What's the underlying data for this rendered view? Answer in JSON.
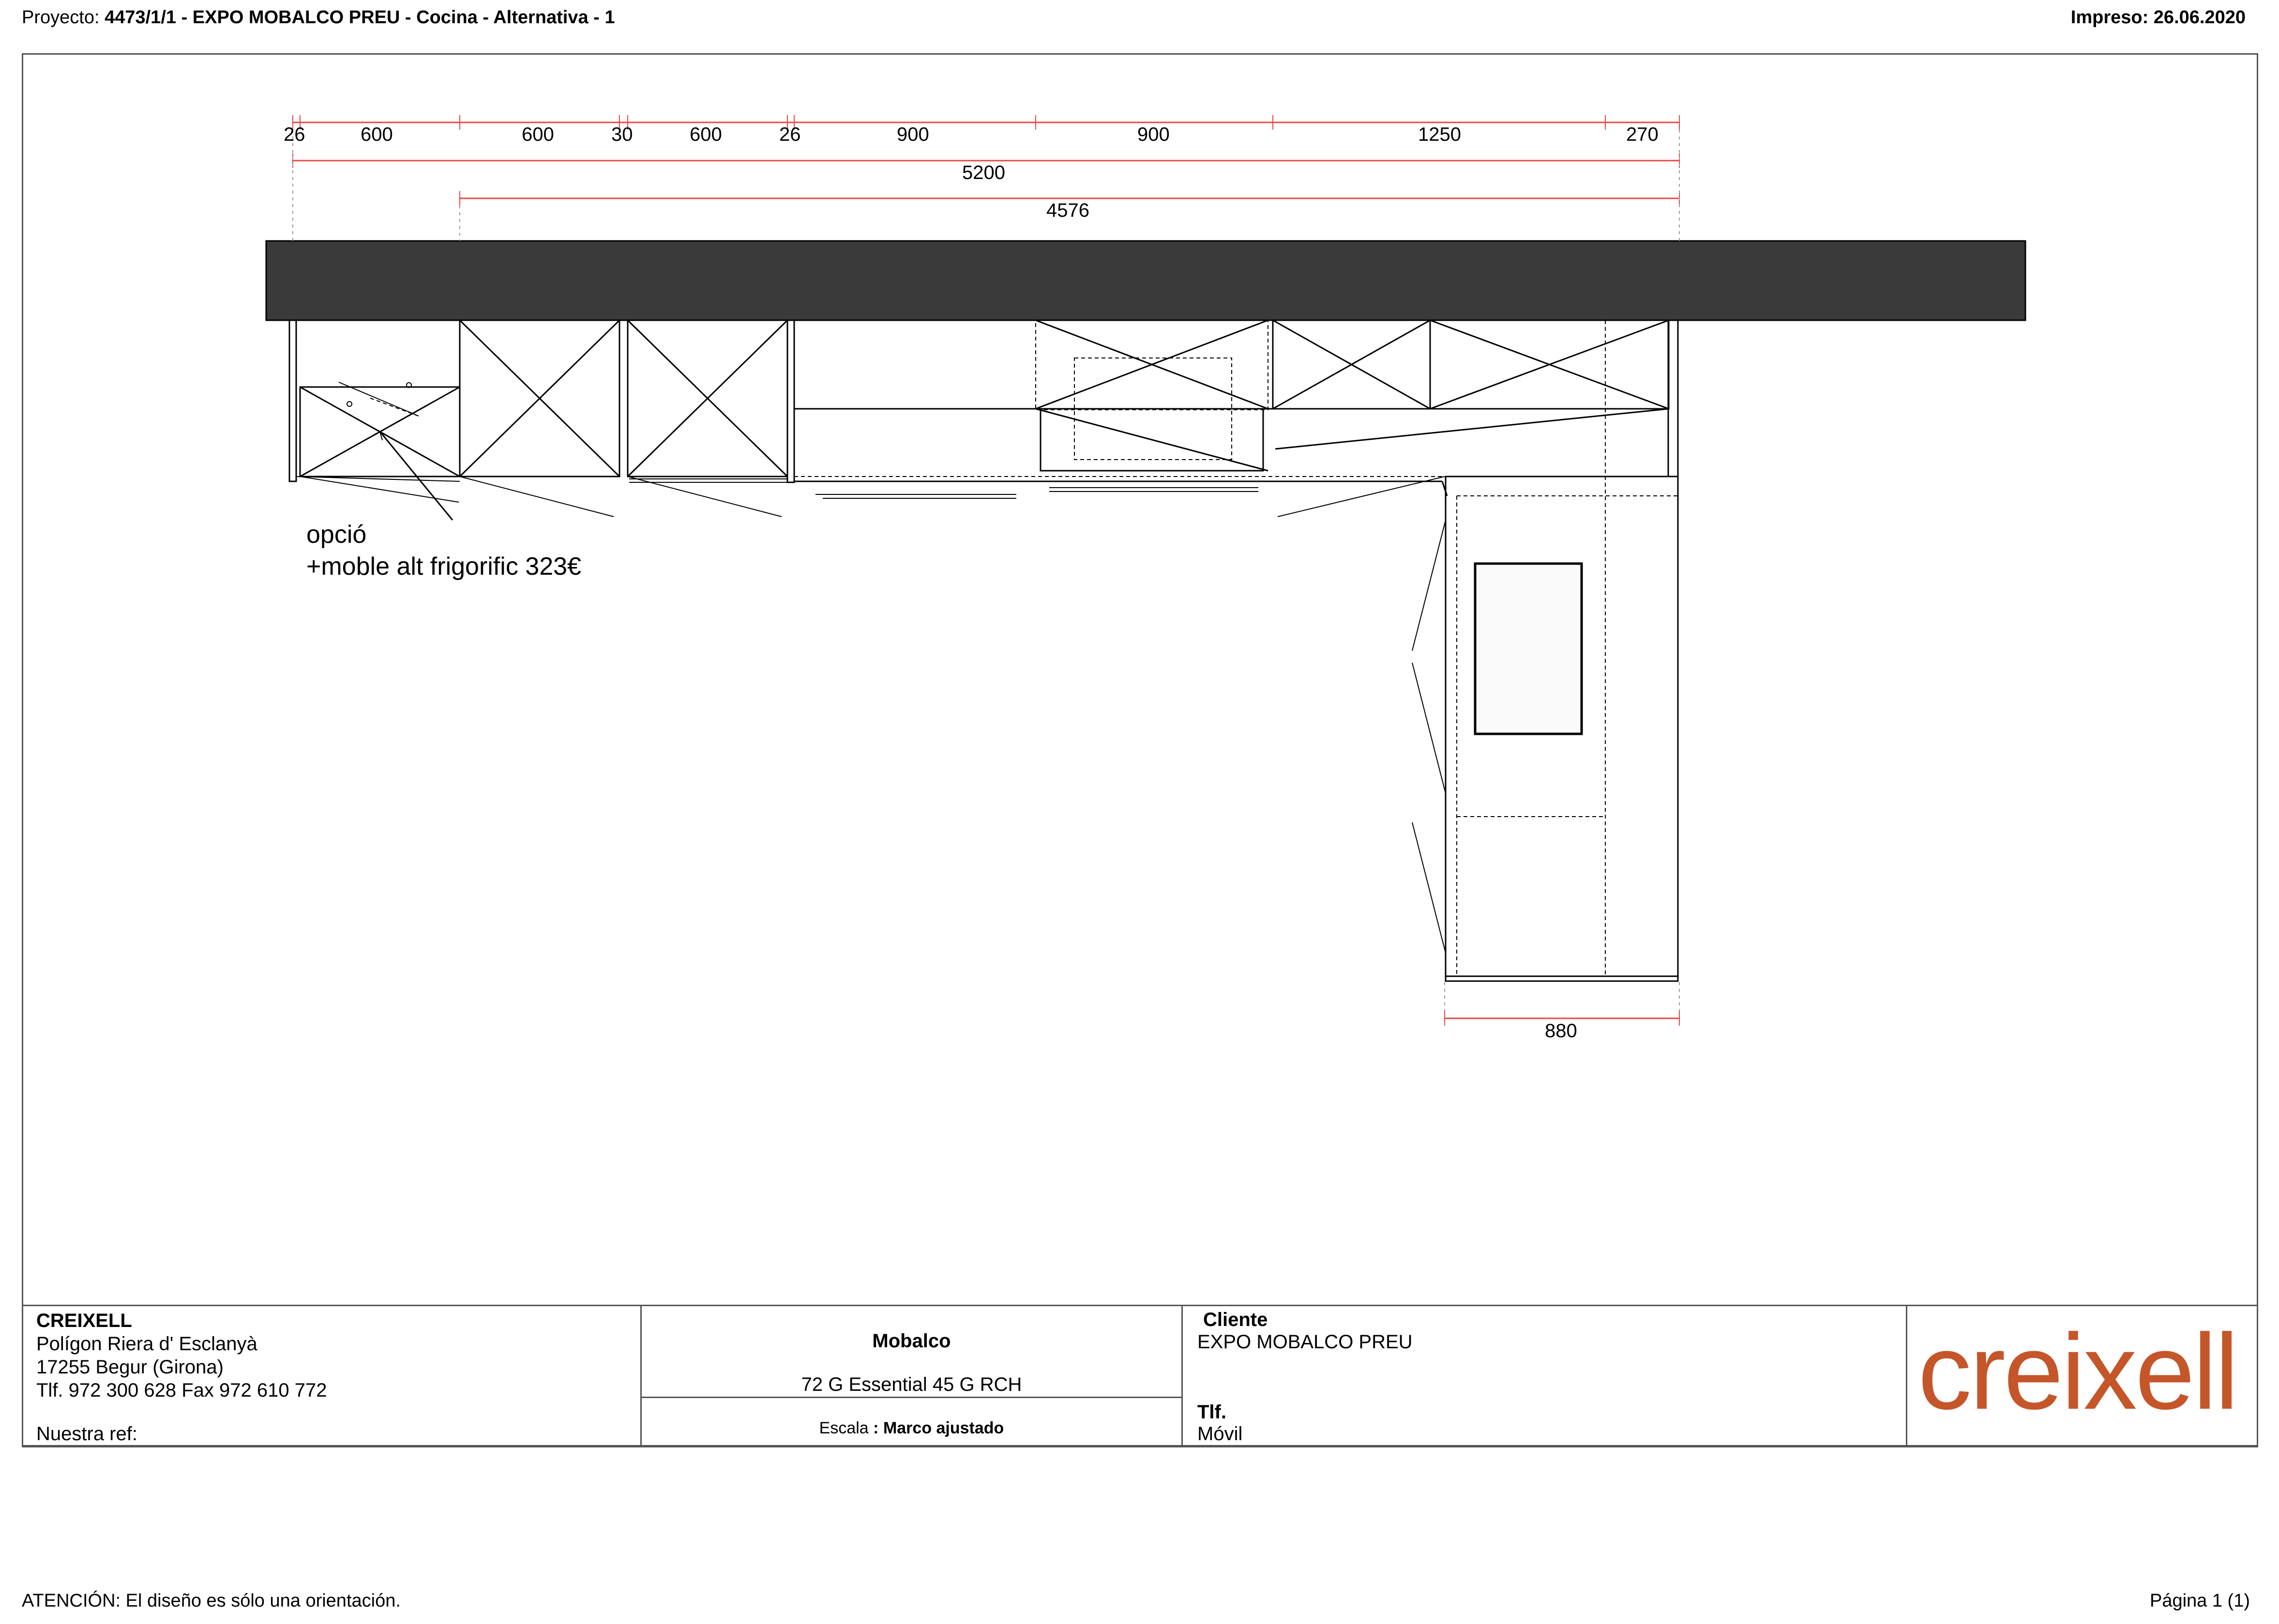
{
  "header": {
    "project_prefix": "Proyecto:",
    "project_name": "4473/1/1 - EXPO MOBALCO PREU - Cocina - Alternativa - 1",
    "printed_label": "Impreso: 26.06.2020"
  },
  "dimensions": {
    "top_row": [
      "26",
      "600",
      "600",
      "30",
      "600",
      "26",
      "900",
      "900",
      "1250",
      "270"
    ],
    "total_1": "5200",
    "total_2": "4576",
    "side": "880"
  },
  "annotation": {
    "line1": "opció",
    "line2": "+moble alt frigorific 323€"
  },
  "title_block": {
    "company": "CREIXELL",
    "address1": "Polígon Riera d' Esclanyà",
    "address2": "17255  Begur (Girona)",
    "phone": "Tlf. 972 300 628 Fax 972 610 772",
    "our_ref": "Nuestra ref:",
    "brand": "Mobalco",
    "model": "72 G Essential 45 G RCH",
    "scale_label": "Escala",
    "scale_value": ": Marco ajustado",
    "client_label": "Cliente",
    "client_name": "EXPO MOBALCO PREU",
    "tlf_label": "Tlf.",
    "mobile_label": "Móvil",
    "logo_text": "creixell"
  },
  "footer": {
    "attention": "ATENCIÓN: El diseño es sólo una orientación.",
    "page": "Página 1 (1)"
  },
  "colors": {
    "dimension_line": "#e84848",
    "countertop": "#3a3a3a",
    "logo": "#c4562a"
  }
}
